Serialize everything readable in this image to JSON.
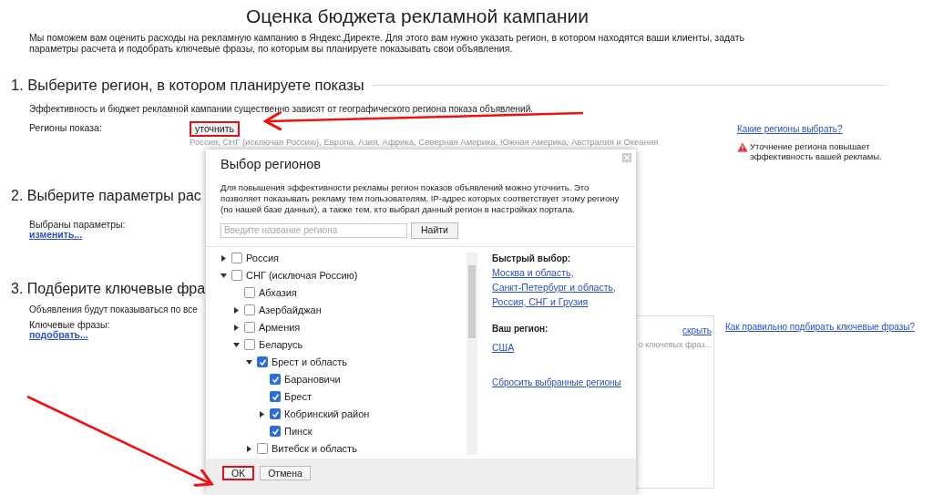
{
  "title": "Оценка бюджета рекламной кампании",
  "intro": "Мы поможем вам оценить расходы на рекламную кампанию в Яндекс.Директе. Для этого вам нужно указать регион, в котором находятся ваши клиенты, задать параметры расчета и подобрать ключевые фразы, по которым вы планируете показывать свои объявления.",
  "section1": {
    "heading": "1. Выберите регион, в котором планируете показы",
    "description": "Эффективность и бюджет рекламной кампании существенно зависят от географического региона показа объявлений.",
    "label": "Регионы показа:",
    "button": {
      "label": "уточнить",
      "highlighted": true
    },
    "regions_text": "Россия, СНГ (исключая Россию), Европа, Азия, Африка, Северная Америка, Южная Америка, Австралия и Океания",
    "help_link": "Какие регионы выбрать?",
    "warning": "Уточнение региона повышает эффективность вашей рекламы."
  },
  "section2": {
    "heading": "2. Выберите параметры рас",
    "label": "Выбраны параметры:",
    "link": "изменить..."
  },
  "section3": {
    "heading": "3. Подберите ключевые фра",
    "description": "Объявления будут показываться по все",
    "label": "Ключевые фразы:",
    "link": "подобрать...",
    "panel_link": "скрыть",
    "panel_text": "о ключевых фраз...",
    "help_link": "Как правильно подбирать ключевые фразы?"
  },
  "dialog": {
    "title": "Выбор регионов",
    "description": "Для повышения эффективности рекламы регион показов объявлений можно уточнить. Это позволяет показывать рекламу тем пользователям, IP-адрес которых соответствует этому региону (по нашей базе данных), а также тем, кто выбрал данный регион в настройках портала.",
    "search": {
      "placeholder": "Введите название региона"
    },
    "search_button": "Найти",
    "tree": [
      {
        "label": "Россия",
        "checked": false,
        "expanded": false
      },
      {
        "label": "СНГ (исключая Россию)",
        "checked": false,
        "expanded": true,
        "children": [
          {
            "label": "Абхазия",
            "checked": false
          },
          {
            "label": "Азербайджан",
            "checked": false,
            "expanded": false
          },
          {
            "label": "Армения",
            "checked": false,
            "expanded": false
          },
          {
            "label": "Беларусь",
            "checked": false,
            "expanded": true,
            "children": [
              {
                "label": "Брест и область",
                "checked": true,
                "expanded": true,
                "children": [
                  {
                    "label": "Барановичи",
                    "checked": true
                  },
                  {
                    "label": "Брест",
                    "checked": true
                  },
                  {
                    "label": "Кобринский район",
                    "checked": true,
                    "expanded": false
                  },
                  {
                    "label": "Пинск",
                    "checked": true
                  }
                ]
              },
              {
                "label": "Витебск и область",
                "checked": false,
                "expanded": false
              }
            ]
          }
        ]
      }
    ],
    "quick_title": "Быстрый выбор:",
    "quick_links": [
      "Москва и область,",
      "Санкт-Петербург и область,",
      "Россия, СНГ и Грузия"
    ],
    "your_region_title": "Ваш регион:",
    "your_region": "США",
    "reset_link": "Сбросить выбранные регионы",
    "buttons": [
      {
        "label": "OK",
        "highlighted": true
      },
      {
        "label": "Отмена",
        "highlighted": false
      }
    ]
  }
}
